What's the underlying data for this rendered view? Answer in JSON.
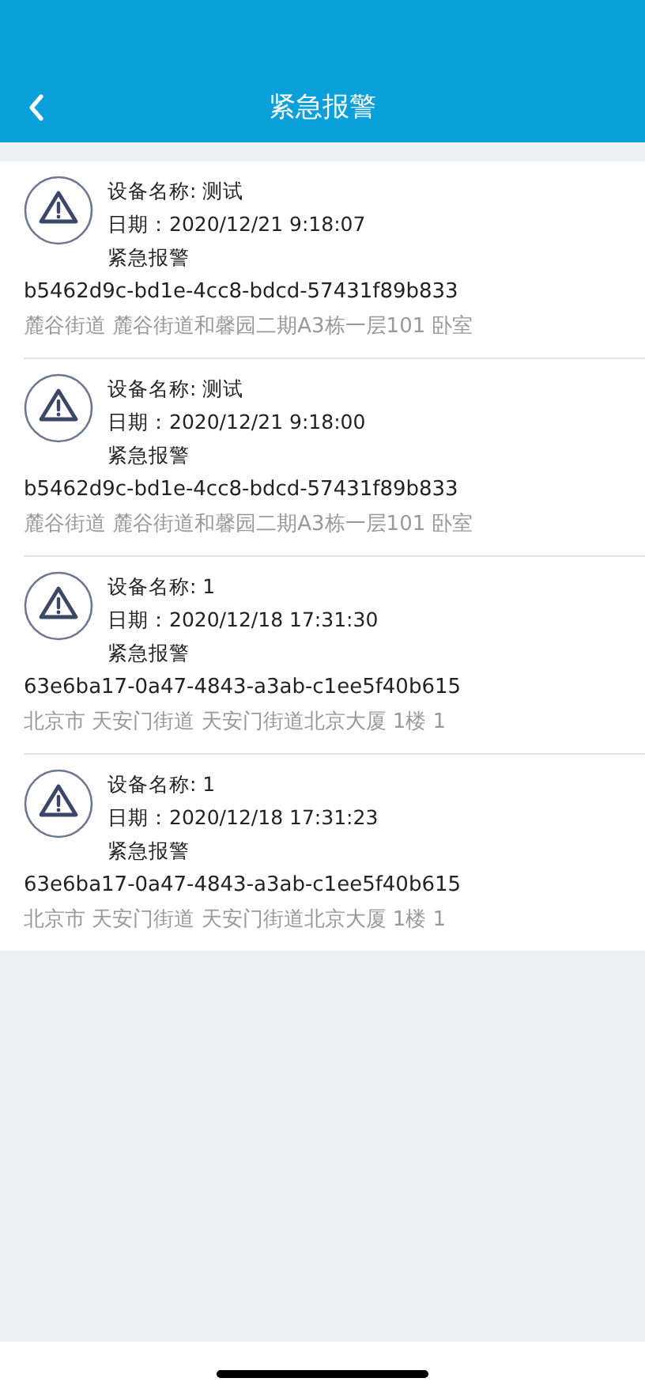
{
  "header": {
    "title": "紧急报警"
  },
  "alarms": [
    {
      "device": "设备名称: 测试",
      "date": "日期：2020/12/21 9:18:07",
      "type": "紧急报警",
      "id": "b5462d9c-bd1e-4cc8-bdcd-57431f89b833",
      "address": "麓谷街道 麓谷街道和馨园二期A3栋一层101 卧室"
    },
    {
      "device": "设备名称: 测试",
      "date": "日期：2020/12/21 9:18:00",
      "type": "紧急报警",
      "id": "b5462d9c-bd1e-4cc8-bdcd-57431f89b833",
      "address": "麓谷街道 麓谷街道和馨园二期A3栋一层101 卧室"
    },
    {
      "device": "设备名称: 1",
      "date": "日期：2020/12/18 17:31:30",
      "type": "紧急报警",
      "id": "63e6ba17-0a47-4843-a3ab-c1ee5f40b615",
      "address": "北京市 天安门街道 天安门街道北京大厦 1楼 1"
    },
    {
      "device": "设备名称: 1",
      "date": "日期：2020/12/18 17:31:23",
      "type": "紧急报警",
      "id": "63e6ba17-0a47-4843-a3ab-c1ee5f40b615",
      "address": "北京市 天安门街道 天安门街道北京大厦 1楼 1"
    }
  ]
}
